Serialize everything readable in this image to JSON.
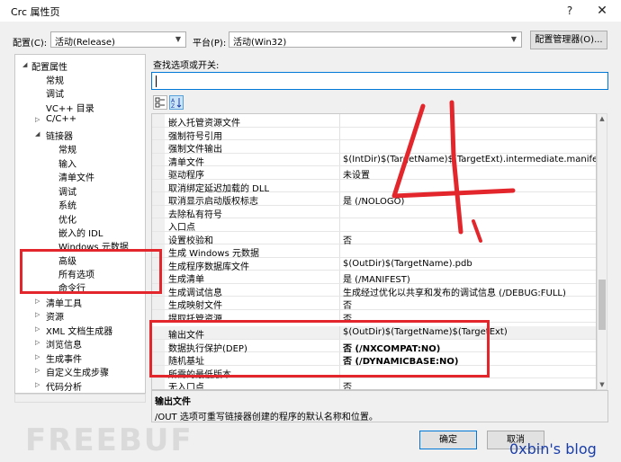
{
  "window": {
    "title": "Crc 属性页",
    "help": "?",
    "close": "✕"
  },
  "config_bar": {
    "config_label": "配置(C):",
    "config_value": "活动(Release)",
    "platform_label": "平台(P):",
    "platform_value": "活动(Win32)",
    "manager_button": "配置管理器(O)..."
  },
  "tree": {
    "root": "配置属性",
    "items": [
      "常规",
      "调试",
      "VC++ 目录",
      "C/C++",
      "链接器",
      "常规",
      "输入",
      "清单文件",
      "调试",
      "系统",
      "优化",
      "嵌入的 IDL",
      "Windows 元数据",
      "高级",
      "所有选项",
      "命令行",
      "清单工具",
      "资源",
      "XML 文档生成器",
      "浏览信息",
      "生成事件",
      "自定义生成步骤",
      "代码分析"
    ]
  },
  "search": {
    "label": "查找选项或开关:",
    "value": ""
  },
  "grid": {
    "rows": [
      {
        "name": "嵌入托管资源文件",
        "value": ""
      },
      {
        "name": "强制符号引用",
        "value": ""
      },
      {
        "name": "强制文件输出",
        "value": ""
      },
      {
        "name": "清单文件",
        "value": "$(IntDir)$(TargetName)$(TargetExt).intermediate.manifest"
      },
      {
        "name": "驱动程序",
        "value": "未设置"
      },
      {
        "name": "取消绑定延迟加载的 DLL",
        "value": ""
      },
      {
        "name": "取消显示启动版权标志",
        "value": "是 (/NOLOGO)"
      },
      {
        "name": "去除私有符号",
        "value": ""
      },
      {
        "name": "入口点",
        "value": ""
      },
      {
        "name": "设置校验和",
        "value": "否"
      },
      {
        "name": "生成 Windows 元数据",
        "value": ""
      },
      {
        "name": "生成程序数据库文件",
        "value": "$(OutDir)$(TargetName).pdb"
      },
      {
        "name": "生成清单",
        "value": "是 (/MANIFEST)"
      },
      {
        "name": "生成调试信息",
        "value": "生成经过优化以共享和发布的调试信息 (/DEBUG:FULL)"
      },
      {
        "name": "生成映射文件",
        "value": "否"
      },
      {
        "name": "提取托管资源",
        "value": "否"
      },
      {
        "name": "输出文件",
        "value": "$(OutDir)$(TargetName)$(TargetExt)"
      },
      {
        "name": "数据执行保护(DEP)",
        "value": "否 (/NXCOMPAT:NO)"
      },
      {
        "name": "随机基址",
        "value": "否 (/DYNAMICBASE:NO)"
      },
      {
        "name": "所需的最低版本",
        "value": ""
      },
      {
        "name": "无入口点",
        "value": "否"
      }
    ]
  },
  "description": {
    "title": "输出文件",
    "text": "/OUT 选项可重写链接器创建的程序的默认名称和位置。"
  },
  "buttons": {
    "ok": "确定",
    "cancel": "取消"
  },
  "annotation": {
    "handwritten": "4."
  },
  "watermarks": {
    "left": "FREEBUF",
    "right": "0xbin's blog"
  },
  "colors": {
    "annotation_red": "#e3262b",
    "accent": "#0078d7",
    "blog_blue": "#1a3ea8"
  }
}
